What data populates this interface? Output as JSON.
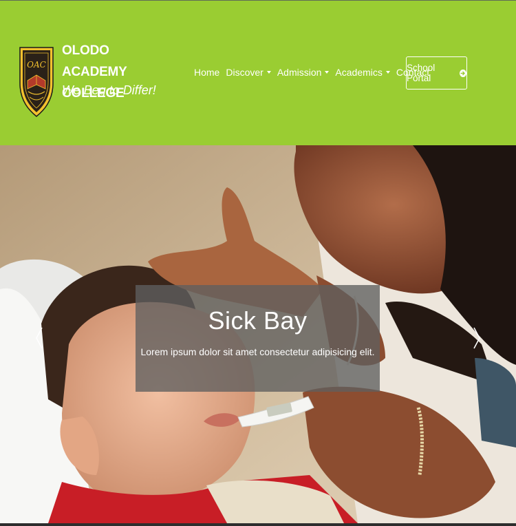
{
  "brand": {
    "name_line1": "OLODO ACADEMY",
    "name_line2": "COLLEGE",
    "tagline": "We Beg to Differ!",
    "crest_text": "OAC",
    "crest_ring_text": "OLODO ACADEMY COLLEGE"
  },
  "nav": {
    "items": [
      {
        "label": "Home",
        "dropdown": false
      },
      {
        "label": "Discover",
        "dropdown": true
      },
      {
        "label": "Admission",
        "dropdown": true
      },
      {
        "label": "Academics",
        "dropdown": true
      },
      {
        "label": "Contact",
        "dropdown": false
      }
    ],
    "portal_label": "School Portal"
  },
  "slide": {
    "title": "Sick Bay",
    "text": "Lorem ipsum dolor sit amet consectetur adipisicing elit."
  },
  "colors": {
    "header_bg": "#9acd32",
    "caption_bg": "#5f5f5f",
    "crest_gold": "#f2c12e",
    "crest_dark": "#2a2118"
  },
  "icons": {
    "portal": "arrow-circle-right-icon",
    "prev": "chevron-left-icon",
    "next": "chevron-right-icon"
  }
}
